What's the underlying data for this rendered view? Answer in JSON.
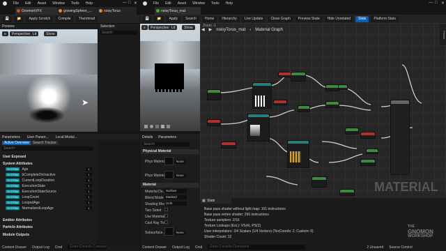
{
  "menu": [
    "File",
    "Edit",
    "Asset",
    "Window",
    "Tools",
    "Help"
  ],
  "tabs_left": [
    "GnomonVFX",
    "growingSphere_...",
    "noisyTorus"
  ],
  "tabs_right": [
    "noisyTorus_mat"
  ],
  "left_toolbar": {
    "save": "Save",
    "apply": "Apply Scratch",
    "compile": "Compile",
    "thumbnail": "Thumbnail"
  },
  "preview_panel": {
    "title": "Preview",
    "perspective": "Perspective",
    "lit": "Lit",
    "show": "Show"
  },
  "selection_panel": {
    "title": "Selection",
    "search_placeholder": "Search"
  },
  "left_bottom_tabs": [
    "Parameters",
    "User Param...",
    "Local Modul..."
  ],
  "params": {
    "buttons": [
      "Active Overview",
      "Search Tracker"
    ],
    "search_placeholder": "Search",
    "user_exposed": "User Exposed",
    "system_attributes": "System Attributes",
    "system_badge": "SYSTEM",
    "items": [
      {
        "name": "Age",
        "idx": "4"
      },
      {
        "name": "bCompleteOnInactive",
        "idx": "1"
      },
      {
        "name": "CurrentLoopDuration",
        "idx": "4"
      },
      {
        "name": "ExecutionState",
        "idx": "1"
      },
      {
        "name": "ExecutionStateSource",
        "idx": "1"
      },
      {
        "name": "LoopCount",
        "idx": "1"
      },
      {
        "name": "LoopedAge",
        "idx": "1"
      },
      {
        "name": "NormalizedLoopAge",
        "idx": "4"
      }
    ],
    "emitter_attributes": "Emitter Attributes",
    "particle_attributes": "Particle Attributes",
    "module_outputs": "Module Outputs"
  },
  "right_toolbar": {
    "save": "Save",
    "apply": "Apply",
    "search": "Search"
  },
  "mat_viewport": {
    "perspective": "Perspective",
    "lit": "Lit",
    "show": "Show"
  },
  "details_tabs": [
    "Details",
    "Parameters"
  ],
  "details": {
    "search_placeholder": "Search",
    "physical_material_header": "Physical Material",
    "phys_material": "Phys Material",
    "phys_materials": "Phys Materials",
    "phys_value": "None",
    "material_header": "Material",
    "rows": [
      {
        "key": "Material Do...",
        "value": "Surface"
      },
      {
        "key": "Blend Mode",
        "value": "Masked"
      },
      {
        "key": "Shading Model",
        "value": "Unlit"
      },
      {
        "key": "Two Sided",
        "value": ""
      },
      {
        "key": "Use Material...",
        "value": ""
      },
      {
        "key": "Cast Ray Tra...",
        "value": ""
      },
      {
        "key": "Subsurface...",
        "value": "None"
      }
    ]
  },
  "graph_toolbar": {
    "home": "Home",
    "hierarchy": "Hierarchy",
    "live_update": "Live Update",
    "clean_graph": "Clean Graph",
    "preview_state": "Preview State",
    "hide_unrelated": "Hide Unrelated",
    "stats": "Stats",
    "platform_stats": "Platform Stats"
  },
  "graph": {
    "zoom": "Zoom -1",
    "breadcrumb_asset": "noisyTorus_mat",
    "breadcrumb_graph": "Material Graph",
    "watermark": "MATERIAL",
    "palette": "Palette"
  },
  "stats": {
    "title": "Stats",
    "lines": [
      "Base pass shader without light map: 101 instructions",
      "Base pass vertex shader: 265 instructions",
      "Texture samplers: 2/16",
      "Texture Lookups (Est.): VS(4), PS(2)",
      "User interpolators: 2/4 Scalars (1/4 Vectors) (TexCoords: 2, Custom: 0)",
      "Shader Count: 12"
    ]
  },
  "logo": {
    "line1": "THE",
    "line2": "GNOMON",
    "line3": "WORKSHOP"
  },
  "statusbar_left": [
    "Content Drawer",
    "Output Log",
    "Cmd"
  ],
  "statusbar_left_placeholder": "Enter Console Command",
  "statusbar_right": [
    "Content Drawer",
    "Output Log",
    "Cmd"
  ],
  "statusbar_right_placeholder": "Enter Console Command",
  "status_right_info": [
    "2 Unsaved",
    "Source Control"
  ],
  "colors": {
    "accent": "#0e5ea8",
    "system_badge": "#0c7f8e",
    "node_green": "#3e8a3e",
    "node_red": "#b03030",
    "node_teal": "#2a7d7d"
  }
}
